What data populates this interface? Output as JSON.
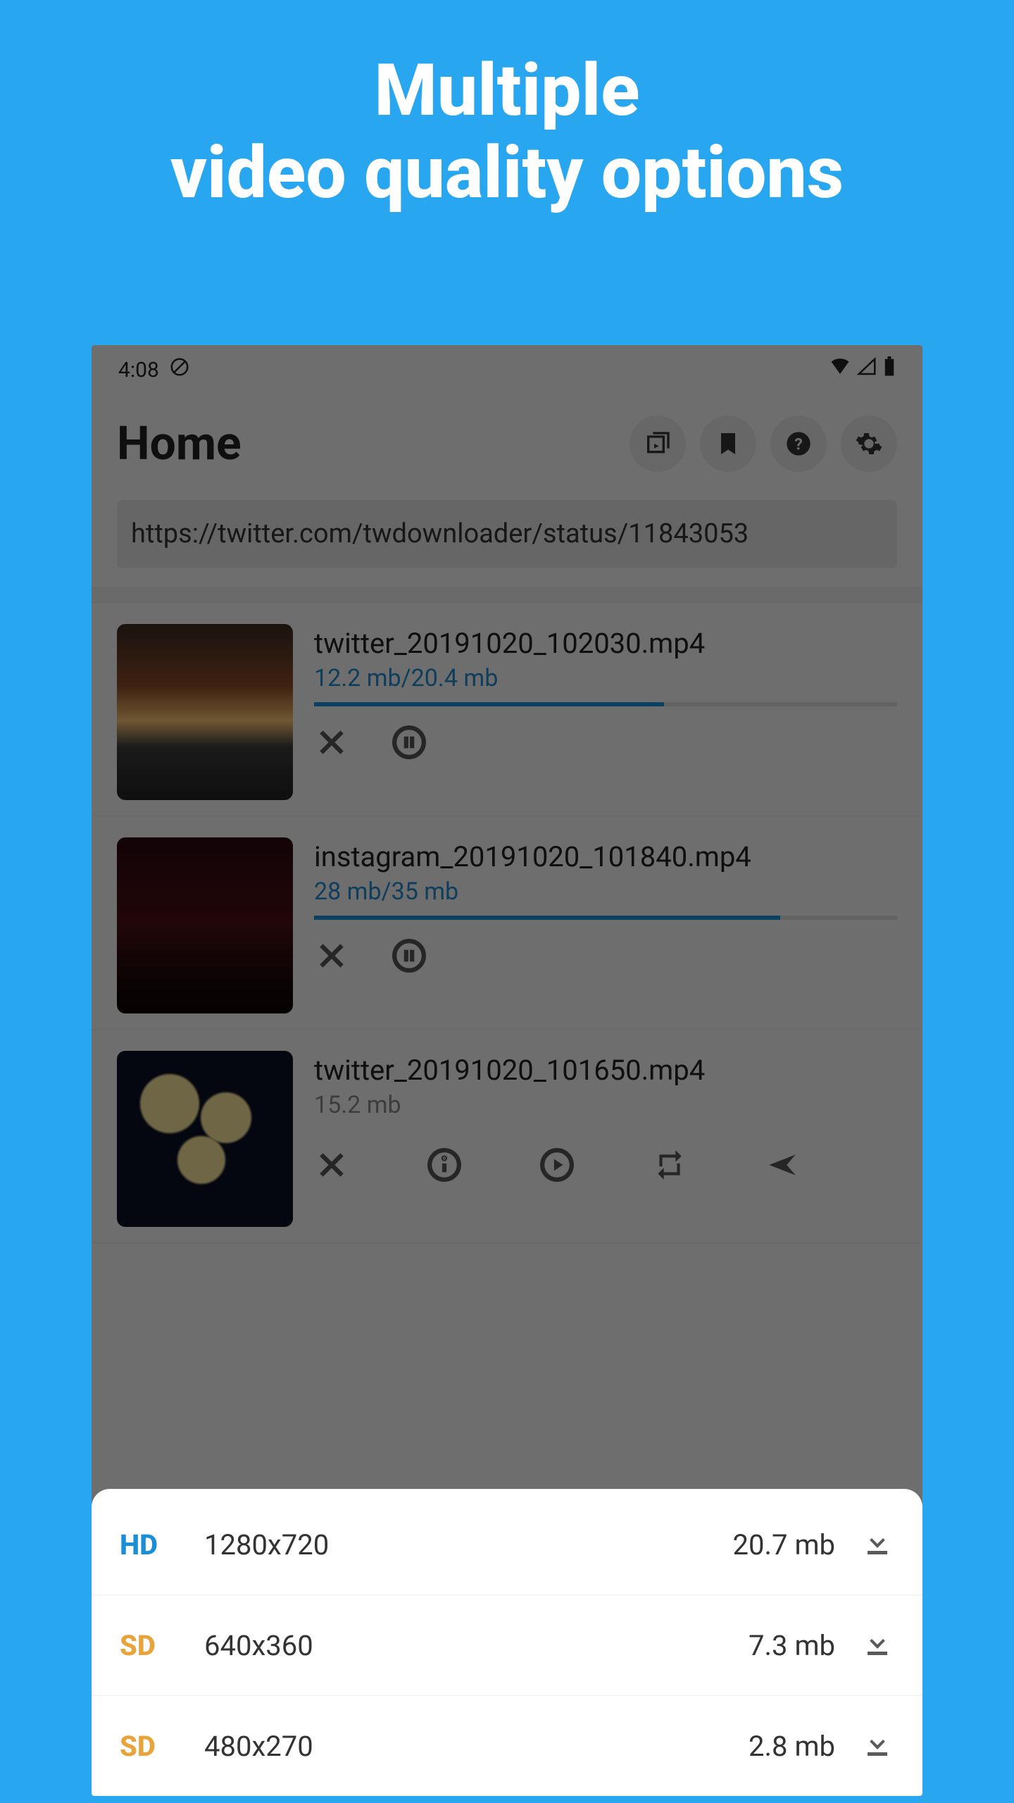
{
  "hero": {
    "line1": "Multiple",
    "line2": "video quality options"
  },
  "status": {
    "time": "4:08"
  },
  "appbar": {
    "title": "Home"
  },
  "url_input": {
    "value": "https://twitter.com/twdownloader/status/11843053"
  },
  "downloads": [
    {
      "filename": "twitter_20191020_102030.mp4",
      "size": "12.2 mb/20.4 mb",
      "progress": 60,
      "state": "downloading"
    },
    {
      "filename": "instagram_20191020_101840.mp4",
      "size": "28 mb/35 mb",
      "progress": 80,
      "state": "downloading"
    },
    {
      "filename": "twitter_20191020_101650.mp4",
      "size": "15.2 mb",
      "progress": null,
      "state": "done"
    }
  ],
  "quality_options": [
    {
      "badge": "HD",
      "badge_class": "hd",
      "resolution": "1280x720",
      "size": "20.7 mb"
    },
    {
      "badge": "SD",
      "badge_class": "sd",
      "resolution": "640x360",
      "size": "7.3 mb"
    },
    {
      "badge": "SD",
      "badge_class": "sd",
      "resolution": "480x270",
      "size": "2.8 mb"
    }
  ]
}
